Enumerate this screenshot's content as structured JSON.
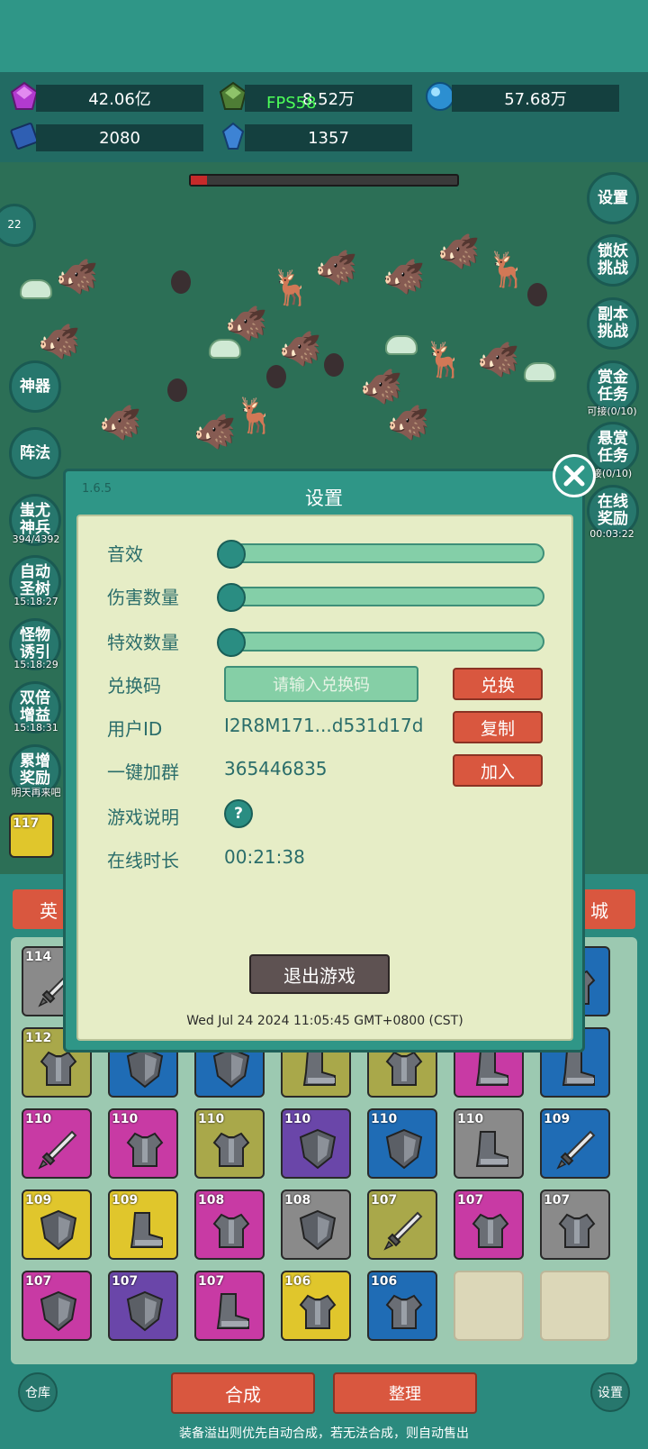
{
  "resources": {
    "gem": "42.06亿",
    "green_gem": "8.52万",
    "orb": "57.68万",
    "book": "2080",
    "crystal": "1357"
  },
  "fps": "FPS58",
  "side_left": {
    "artifact": "神器",
    "formation": "阵法",
    "chiyou": "蚩尤\n神兵",
    "chiyou_sub": "394/4392",
    "auto_tree": "自动\n圣树",
    "auto_tree_sub": "15:18:27",
    "lure": "怪物\n诱引",
    "lure_sub": "15:18:29",
    "double": "双倍\n增益",
    "double_sub": "15:18:31",
    "accum": "累增\n奖励",
    "accum_sub": "明天再来吧",
    "badge": "22"
  },
  "side_right": {
    "settings": "设置",
    "lock_demon": "锁妖\n挑战",
    "dungeon": "副本\n挑战",
    "bounty": "赏金\n任务",
    "bounty_sub": "可接(0/10)",
    "reward": "悬赏\n任务",
    "reward_sub": "接(0/10)",
    "online": "在线\n奖励",
    "online_sub": "00:03:22"
  },
  "tabs": {
    "hero": "英",
    "shop": "城"
  },
  "slot_level": "117",
  "grid": [
    {
      "lvl": "114",
      "color": "c-gray",
      "item": "sword"
    },
    {
      "lvl": "",
      "color": "c-gray",
      "item": "shield"
    },
    {
      "lvl": "",
      "color": "c-blue",
      "item": "armor"
    },
    {
      "lvl": "",
      "color": "c-blue",
      "item": "armor"
    },
    {
      "lvl": "",
      "color": "c-green",
      "item": "armor"
    },
    {
      "lvl": "",
      "color": "c-pink",
      "item": "boot"
    },
    {
      "lvl": "",
      "color": "c-blue",
      "item": "armor"
    },
    {
      "lvl": "112",
      "color": "c-green",
      "item": "armor"
    },
    {
      "lvl": "",
      "color": "c-blue",
      "item": "shield"
    },
    {
      "lvl": "",
      "color": "c-blue",
      "item": "shield"
    },
    {
      "lvl": "",
      "color": "c-green",
      "item": "boot"
    },
    {
      "lvl": "",
      "color": "c-green",
      "item": "armor"
    },
    {
      "lvl": "",
      "color": "c-pink",
      "item": "boot"
    },
    {
      "lvl": "",
      "color": "c-blue",
      "item": "boot"
    },
    {
      "lvl": "110",
      "color": "c-pink",
      "item": "sword"
    },
    {
      "lvl": "110",
      "color": "c-pink",
      "item": "armor"
    },
    {
      "lvl": "110",
      "color": "c-green",
      "item": "armor"
    },
    {
      "lvl": "110",
      "color": "c-purple",
      "item": "shield"
    },
    {
      "lvl": "110",
      "color": "c-blue",
      "item": "shield"
    },
    {
      "lvl": "110",
      "color": "c-gray",
      "item": "boot"
    },
    {
      "lvl": "109",
      "color": "c-blue",
      "item": "sword"
    },
    {
      "lvl": "109",
      "color": "c-yellow",
      "item": "shield"
    },
    {
      "lvl": "109",
      "color": "c-yellow",
      "item": "boot"
    },
    {
      "lvl": "108",
      "color": "c-pink",
      "item": "armor"
    },
    {
      "lvl": "108",
      "color": "c-gray",
      "item": "shield"
    },
    {
      "lvl": "107",
      "color": "c-green",
      "item": "sword"
    },
    {
      "lvl": "107",
      "color": "c-pink",
      "item": "armor"
    },
    {
      "lvl": "107",
      "color": "c-gray",
      "item": "armor"
    },
    {
      "lvl": "107",
      "color": "c-pink",
      "item": "shield"
    },
    {
      "lvl": "107",
      "color": "c-purple",
      "item": "shield"
    },
    {
      "lvl": "107",
      "color": "c-pink",
      "item": "boot"
    },
    {
      "lvl": "106",
      "color": "c-yellow",
      "item": "armor"
    },
    {
      "lvl": "106",
      "color": "c-blue",
      "item": "armor"
    },
    {
      "lvl": "",
      "color": "c-empty",
      "item": ""
    },
    {
      "lvl": "",
      "color": "c-empty",
      "item": ""
    }
  ],
  "bottom": {
    "warehouse": "仓库",
    "synth": "合成",
    "arrange": "整理",
    "settings": "设置",
    "note": "装备溢出则优先自动合成，若无法合成，则自动售出"
  },
  "dialog": {
    "version": "1.6.5",
    "title": "设置",
    "sound_label": "音效",
    "damage_label": "伤害数量",
    "effect_label": "特效数量",
    "sound_level": 0,
    "damage_level": 0,
    "effect_level": 0,
    "code_label": "兑换码",
    "code_placeholder": "请输入兑换码",
    "code_button": "兑换",
    "uid_label": "用户ID",
    "uid_value": "I2R8M171...d531d17d",
    "uid_button": "复制",
    "group_label": "一键加群",
    "group_value": "365446835",
    "group_button": "加入",
    "help_label": "游戏说明",
    "help_icon": "?",
    "online_label": "在线时长",
    "online_value": "00:21:38",
    "exit_button": "退出游戏",
    "datetime": "Wed Jul 24 2024 11:05:45 GMT+0800 (CST)"
  }
}
